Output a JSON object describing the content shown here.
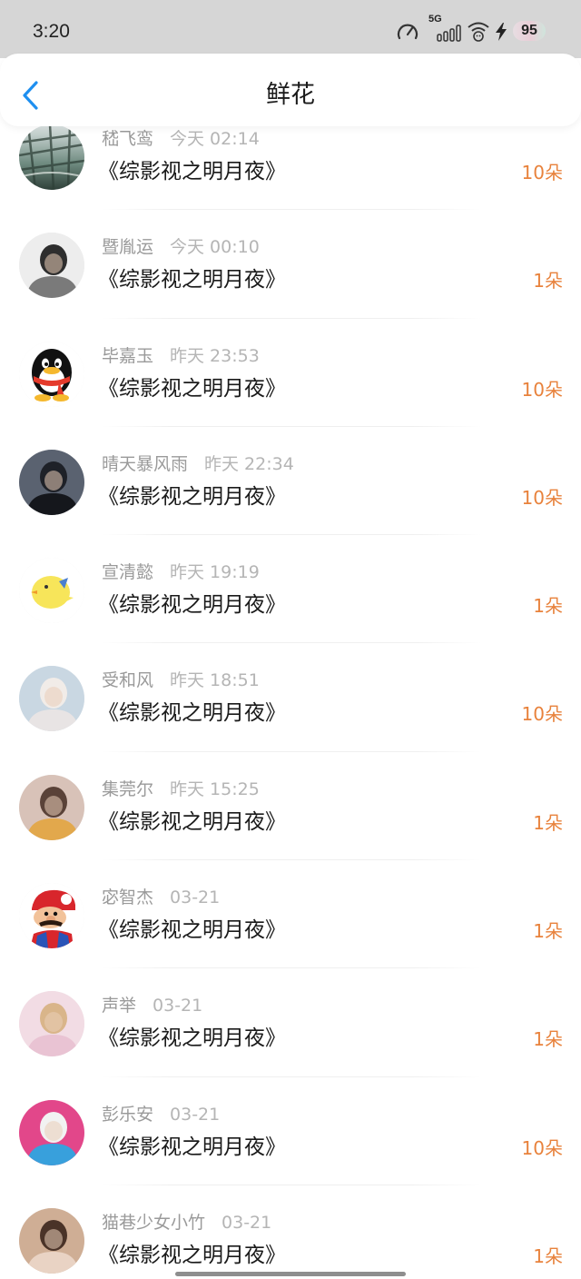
{
  "status_bar": {
    "time": "3:20",
    "network_label": "5G",
    "battery_level": "95",
    "icons": [
      "speedometer-icon",
      "signal-bars-icon",
      "wifi-icon",
      "charging-bolt-icon"
    ]
  },
  "header": {
    "back_icon": "chevron-left-icon",
    "title": "鲜花"
  },
  "colors": {
    "accent": "#1e8ff0",
    "amount": "#e8823c",
    "name": "#9a9a9a",
    "time": "#b5b5b5",
    "status_bar_bg": "#d6d6d6"
  },
  "records": [
    {
      "name": "嵇飞鸾",
      "time": "今天 02:14",
      "work": "《综影视之明月夜》",
      "amount": "10朵",
      "avatar": {
        "kind": "bridge-scene-avatar",
        "colors": [
          "#dfe6e6",
          "#6e8a7f",
          "#2f4039"
        ]
      }
    },
    {
      "name": "暨胤运",
      "time": "今天 00:10",
      "work": "《综影视之明月夜》",
      "amount": "1朵",
      "avatar": {
        "kind": "portrait-photo-avatar",
        "colors": [
          "#ededed",
          "#2e2e2e",
          "#7a7a7a"
        ]
      }
    },
    {
      "name": "毕嘉玉",
      "time": "昨天 23:53",
      "work": "《综影视之明月夜》",
      "amount": "10朵",
      "avatar": {
        "kind": "qq-penguin-avatar",
        "colors": [
          "#ffffff",
          "#111111",
          "#e53a2b"
        ]
      }
    },
    {
      "name": "晴天暴风雨",
      "time": "昨天 22:34",
      "work": "《综影视之明月夜》",
      "amount": "10朵",
      "avatar": {
        "kind": "portrait-photo-avatar",
        "colors": [
          "#5a6270",
          "#1e2128",
          "#15171c"
        ]
      }
    },
    {
      "name": "宣清懿",
      "time": "昨天 19:19",
      "work": "《综影视之明月夜》",
      "amount": "1朵",
      "avatar": {
        "kind": "yellow-chick-avatar",
        "colors": [
          "#ffffff",
          "#f7e55a",
          "#4a7fd0"
        ]
      }
    },
    {
      "name": "受和风",
      "time": "昨天 18:51",
      "work": "《综影视之明月夜》",
      "amount": "10朵",
      "avatar": {
        "kind": "portrait-photo-avatar",
        "colors": [
          "#c9d7e2",
          "#f1ece8",
          "#e8e4e4"
        ]
      }
    },
    {
      "name": "集莞尔",
      "time": "昨天 15:25",
      "work": "《综影视之明月夜》",
      "amount": "1朵",
      "avatar": {
        "kind": "portrait-photo-avatar",
        "colors": [
          "#d8c2b8",
          "#5a4238",
          "#e2a84c"
        ]
      }
    },
    {
      "name": "宓智杰",
      "time": "03-21",
      "work": "《综影视之明月夜》",
      "amount": "1朵",
      "avatar": {
        "kind": "mario-avatar",
        "colors": [
          "#ffffff",
          "#d8262c",
          "#2a55b8"
        ]
      }
    },
    {
      "name": "声举",
      "time": "03-21",
      "work": "《综影视之明月夜》",
      "amount": "1朵",
      "avatar": {
        "kind": "portrait-photo-avatar",
        "colors": [
          "#f2dce4",
          "#d9b58a",
          "#e9c3d3"
        ]
      }
    },
    {
      "name": "彭乐安",
      "time": "03-21",
      "work": "《综影视之明月夜》",
      "amount": "10朵",
      "avatar": {
        "kind": "portrait-photo-avatar",
        "colors": [
          "#e2478a",
          "#f2f2f2",
          "#38a0dc"
        ]
      }
    },
    {
      "name": "猫巷少女小竹",
      "time": "03-21",
      "work": "《综影视之明月夜》",
      "amount": "1朵",
      "avatar": {
        "kind": "portrait-photo-avatar",
        "colors": [
          "#cfae95",
          "#4a3328",
          "#e9d3c4"
        ]
      }
    }
  ]
}
